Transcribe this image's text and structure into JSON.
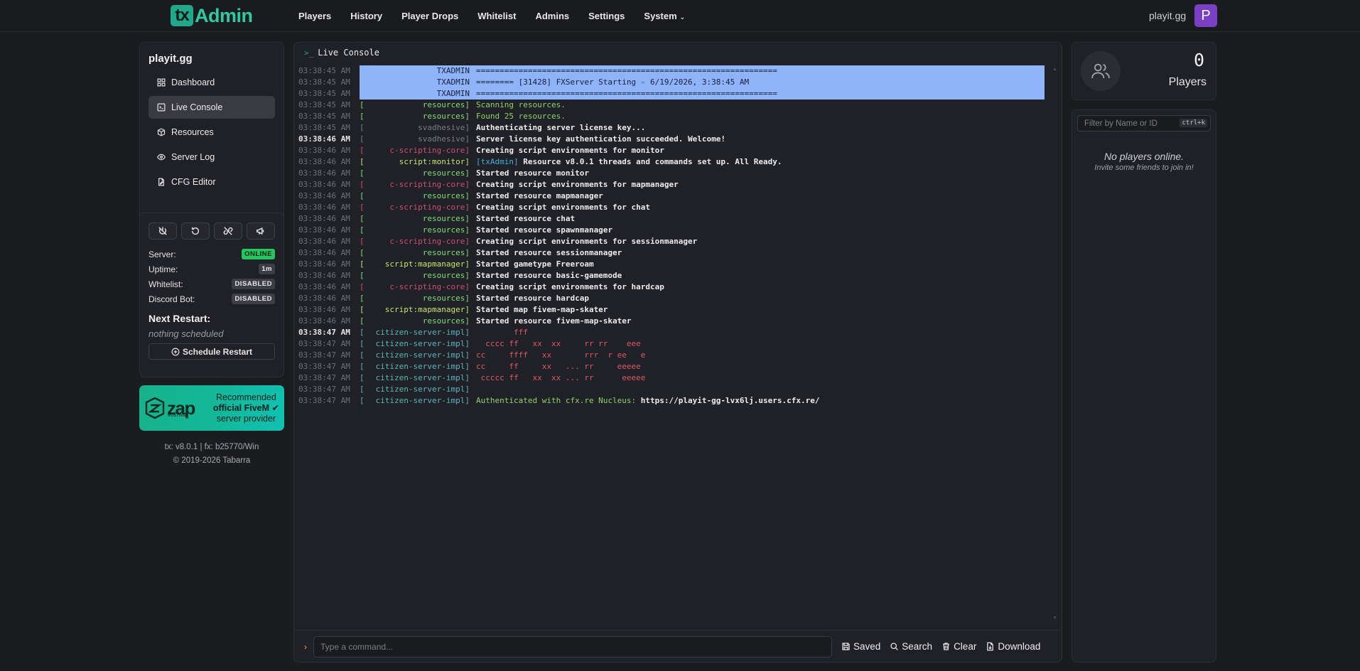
{
  "header": {
    "logo_tx": "tx",
    "logo_admin": "Admin",
    "nav": [
      "Players",
      "History",
      "Player Drops",
      "Whitelist",
      "Admins",
      "Settings",
      "System"
    ],
    "username": "playit.gg",
    "avatar_letter": "P",
    "avatar_color": "#7b3fc4"
  },
  "sidebar": {
    "server_name": "playit.gg",
    "menu": [
      {
        "label": "Dashboard",
        "icon": "dashboard-icon"
      },
      {
        "label": "Live Console",
        "icon": "terminal-icon",
        "active": true
      },
      {
        "label": "Resources",
        "icon": "box-icon"
      },
      {
        "label": "Server Log",
        "icon": "eye-icon"
      },
      {
        "label": "CFG Editor",
        "icon": "file-edit-icon"
      }
    ],
    "controls": [
      "power-off-icon",
      "restart-icon",
      "unlink-icon",
      "megaphone-icon"
    ],
    "status": {
      "server_label": "Server:",
      "server_value": "ONLINE",
      "uptime_label": "Uptime:",
      "uptime_value": "1m",
      "whitelist_label": "Whitelist:",
      "whitelist_value": "DISABLED",
      "discord_label": "Discord Bot:",
      "discord_value": "DISABLED"
    },
    "next_restart_title": "Next Restart:",
    "next_restart_value": "nothing scheduled",
    "schedule_button": "Schedule Restart",
    "zap": {
      "word": "zap",
      "sub": "HOSTING",
      "line1": "Recommended",
      "line2": "official FiveM",
      "line3": "server provider"
    },
    "version_line": "tx: v8.0.1 | fx: b25770/Win",
    "copyright": "© 2019-2026 Tabarra"
  },
  "console": {
    "title": "Live Console",
    "lines": [
      {
        "ts": "03:38:45 AM",
        "ctx": "TXADMIN",
        "msg": "================================================================",
        "style": "hl"
      },
      {
        "ts": "03:38:45 AM",
        "ctx": "TXADMIN",
        "msg": "======== [31428] FXServer Starting - 6/19/2026, 3:38:45 AM",
        "style": "hl"
      },
      {
        "ts": "03:38:45 AM",
        "ctx": "TXADMIN",
        "msg": "================================================================",
        "style": "hl"
      },
      {
        "ts": "03:38:45 AM",
        "ctx": "resources",
        "msg": "Scanning resources.",
        "ctxc": "c-res",
        "msgc": "m-green"
      },
      {
        "ts": "03:38:45 AM",
        "ctx": "resources",
        "msg": "Found 25 resources.",
        "ctxc": "c-res",
        "msgc": "m-green"
      },
      {
        "ts": "03:38:45 AM",
        "ctx": "svadhesive",
        "msg": "Authenticating server license key...",
        "ctxc": "c-sva"
      },
      {
        "ts": "03:38:46 AM",
        "ctx": "svadhesive",
        "msg": "Server license key authentication succeeded. Welcome!",
        "ctxc": "c-sva",
        "bright": true
      },
      {
        "ts": "03:38:46 AM",
        "ctx": "c-scripting-core",
        "msg": "Creating script environments for monitor",
        "ctxc": "c-core"
      },
      {
        "ts": "03:38:46 AM",
        "ctx": "script:monitor",
        "pre": "[txAdmin]",
        "msg": "Resource v8.0.1 threads and commands set up. All Ready.",
        "ctxc": "c-mon"
      },
      {
        "ts": "03:38:46 AM",
        "ctx": "resources",
        "msg": "Started resource monitor",
        "ctxc": "c-res"
      },
      {
        "ts": "03:38:46 AM",
        "ctx": "c-scripting-core",
        "msg": "Creating script environments for mapmanager",
        "ctxc": "c-core"
      },
      {
        "ts": "03:38:46 AM",
        "ctx": "resources",
        "msg": "Started resource mapmanager",
        "ctxc": "c-res"
      },
      {
        "ts": "03:38:46 AM",
        "ctx": "c-scripting-core",
        "msg": "Creating script environments for chat",
        "ctxc": "c-core"
      },
      {
        "ts": "03:38:46 AM",
        "ctx": "resources",
        "msg": "Started resource chat",
        "ctxc": "c-res"
      },
      {
        "ts": "03:38:46 AM",
        "ctx": "resources",
        "msg": "Started resource spawnmanager",
        "ctxc": "c-res"
      },
      {
        "ts": "03:38:46 AM",
        "ctx": "c-scripting-core",
        "msg": "Creating script environments for sessionmanager",
        "ctxc": "c-core"
      },
      {
        "ts": "03:38:46 AM",
        "ctx": "resources",
        "msg": "Started resource sessionmanager",
        "ctxc": "c-res"
      },
      {
        "ts": "03:38:46 AM",
        "ctx": "script:mapmanager",
        "msg": "Started gametype Freeroam",
        "ctxc": "c-mon"
      },
      {
        "ts": "03:38:46 AM",
        "ctx": "resources",
        "msg": "Started resource basic-gamemode",
        "ctxc": "c-res"
      },
      {
        "ts": "03:38:46 AM",
        "ctx": "c-scripting-core",
        "msg": "Creating script environments for hardcap",
        "ctxc": "c-core"
      },
      {
        "ts": "03:38:46 AM",
        "ctx": "resources",
        "msg": "Started resource hardcap",
        "ctxc": "c-res"
      },
      {
        "ts": "03:38:46 AM",
        "ctx": "script:mapmanager",
        "msg": "Started map fivem-map-skater",
        "ctxc": "c-mon"
      },
      {
        "ts": "03:38:46 AM",
        "ctx": "resources",
        "msg": "Started resource fivem-map-skater",
        "ctxc": "c-res"
      },
      {
        "ts": "03:38:47 AM",
        "ctx": "citizen-server-impl",
        "msg": "        fff",
        "ctxc": "c-csi",
        "msgc": "m-red",
        "bright": true
      },
      {
        "ts": "03:38:47 AM",
        "ctx": "citizen-server-impl",
        "msg": "  cccc ff   xx  xx     rr rr    eee",
        "ctxc": "c-csi",
        "msgc": "m-red"
      },
      {
        "ts": "03:38:47 AM",
        "ctx": "citizen-server-impl",
        "msg": "cc     ffff   xx       rrr  r ee   e",
        "ctxc": "c-csi",
        "msgc": "m-red"
      },
      {
        "ts": "03:38:47 AM",
        "ctx": "citizen-server-impl",
        "msg": "cc     ff     xx   ... rr     eeeee",
        "ctxc": "c-csi",
        "msgc": "m-red"
      },
      {
        "ts": "03:38:47 AM",
        "ctx": "citizen-server-impl",
        "msg": " ccccc ff   xx  xx ... rr      eeeee",
        "ctxc": "c-csi",
        "msgc": "m-red"
      },
      {
        "ts": "03:38:47 AM",
        "ctx": "citizen-server-impl",
        "msg": "",
        "ctxc": "c-csi"
      },
      {
        "ts": "03:38:47 AM",
        "ctx": "citizen-server-impl",
        "pre": "Authenticated with cfx.re Nucleus:",
        "msg": "https://playit-gg-lvx6lj.users.cfx.re/",
        "ctxc": "c-csi",
        "prec": "m-green"
      }
    ],
    "input_placeholder": "Type a command...",
    "buttons": [
      "Saved",
      "Search",
      "Clear",
      "Download"
    ]
  },
  "players": {
    "count": "0",
    "label": "Players",
    "filter_placeholder": "Filter by Name or ID",
    "shortcut": "ctrl+k",
    "empty_title": "No players online.",
    "empty_sub": "Invite some friends to join in!"
  },
  "colors": {
    "accent": "#1fa98a",
    "online": "#22c55e",
    "selection": "#8fb3f8"
  }
}
